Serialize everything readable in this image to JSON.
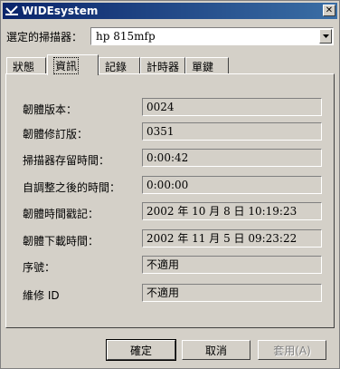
{
  "window": {
    "title": "WIDEsystem"
  },
  "scanner": {
    "label": "選定的掃描器：",
    "value": "hp 815mfp"
  },
  "tabs": [
    {
      "label": "狀態",
      "active": false
    },
    {
      "label": "資訊",
      "active": true
    },
    {
      "label": "記錄",
      "active": false
    },
    {
      "label": "計時器",
      "active": false
    },
    {
      "label": "單鍵",
      "active": false
    }
  ],
  "info": {
    "fields": [
      {
        "label": "韌體版本：",
        "value": "0024"
      },
      {
        "label": "韌體修訂版：",
        "value": "0351"
      },
      {
        "label": "掃描器存留時間：",
        "value": "0:00:42"
      },
      {
        "label": "自調整之後的時間：",
        "value": "0:00:00"
      },
      {
        "label": "韌體時間戳記：",
        "value": "2002 年 10 月 8 日 10:19:23"
      },
      {
        "label": "韌體下載時間：",
        "value": "2002 年 11 月 5 日 09:23:22"
      },
      {
        "label": "序號：",
        "value": "不適用"
      },
      {
        "label": "維修 ID",
        "value": "不適用"
      }
    ]
  },
  "buttons": {
    "ok": "確定",
    "cancel": "取消",
    "apply": "套用(A)"
  }
}
